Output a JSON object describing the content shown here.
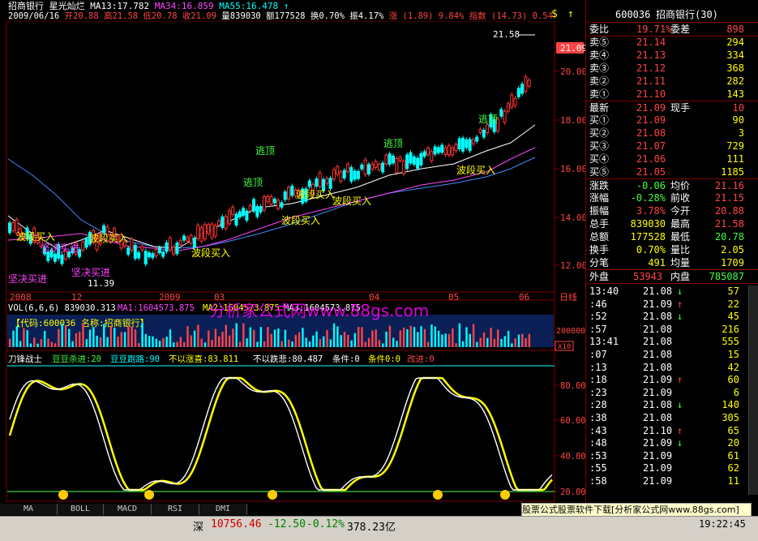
{
  "window": {
    "stock_name": "招商银行",
    "indicator_name": "星光灿烂",
    "ma13": "MA13:17.782",
    "ma34": "MA34:16.859",
    "ma55": "MA55:16.478",
    "date": "2009/06/16",
    "open": "开20.88",
    "high": "高21.58",
    "low": "低20.78",
    "close": "收21.09",
    "volume": "量839030",
    "amount": "额177528",
    "turnover": "换0.70%",
    "amplitude": "振4.17%",
    "change": "涨 (1.89) 9.84%",
    "index": "指数 (14.73) 0.54",
    "top_price": "21.58",
    "last_price": "21.09"
  },
  "price_axis": [
    "20.00",
    "18.00",
    "16.00",
    "14.00",
    "12.00"
  ],
  "date_axis": [
    "2008",
    "12",
    "2009",
    "03",
    "04",
    "05",
    "06"
  ],
  "date_axis_label": "日线",
  "annotations": {
    "escape": "逃顶",
    "band_buy": "波段买入",
    "decisive_buy": "坚决买进",
    "low_price": "11.39"
  },
  "volume_panel": {
    "header": "VOL(6,6,6) 839030.313",
    "ma1": "MA1:1604573.875",
    "ma2": "MA2:1604573.875",
    "ma3": "MA3:1604573.875",
    "code_label": "【代码:600036 名称:招商银行】",
    "axis_label": "200000",
    "x10": "X10"
  },
  "watermark": "分析家公式网www.88gs.com",
  "oscillator": {
    "name": "刀锋战士",
    "p1": "豆豆杀进:20",
    "p2": "豆豆跑路:90",
    "p3": "不以涨喜:83.811",
    "p4": "不以跌悲:80.487",
    "p5": "条件:0",
    "p6": "条件0:0",
    "p7": "改进:0",
    "axis": [
      "80.00",
      "60.00",
      "40.00",
      "20.00"
    ],
    "smiley_count": 5
  },
  "tabs": [
    "MA",
    "BOLL",
    "MACD",
    "RSI",
    "DMI"
  ],
  "quote": {
    "code": "600036",
    "name": "招商银行(30)",
    "weibi_label": "委比",
    "weibi_value": "19.71%",
    "weicha_label": "委差",
    "weicha_value": "898",
    "asks": [
      {
        "label": "卖⑤",
        "price": "21.14",
        "vol": "294"
      },
      {
        "label": "卖④",
        "price": "21.13",
        "vol": "334"
      },
      {
        "label": "卖③",
        "price": "21.12",
        "vol": "368"
      },
      {
        "label": "卖②",
        "price": "21.11",
        "vol": "282"
      },
      {
        "label": "卖①",
        "price": "21.10",
        "vol": "143"
      }
    ],
    "latest_label": "最新",
    "latest_value": "21.09",
    "hand_label": "现手",
    "hand_value": "10",
    "bids": [
      {
        "label": "买①",
        "price": "21.09",
        "vol": "90"
      },
      {
        "label": "买②",
        "price": "21.08",
        "vol": "3"
      },
      {
        "label": "买③",
        "price": "21.07",
        "vol": "729"
      },
      {
        "label": "买④",
        "price": "21.06",
        "vol": "111"
      },
      {
        "label": "买⑤",
        "price": "21.05",
        "vol": "1185"
      }
    ],
    "stats": [
      {
        "l1": "涨跌",
        "v1": "-0.06",
        "l2": "均价",
        "v2": "21.16"
      },
      {
        "l1": "涨幅",
        "v1": "-0.28%",
        "l2": "前收",
        "v2": "21.15"
      },
      {
        "l1": "振幅",
        "v1": "3.78%",
        "l2": "今开",
        "v2": "20.88"
      },
      {
        "l1": "总手",
        "v1": "839030",
        "l2": "最高",
        "v2": "21.58"
      },
      {
        "l1": "总额",
        "v1": "177528",
        "l2": "最低",
        "v2": "20.78"
      },
      {
        "l1": "换手",
        "v1": "0.70%",
        "l2": "量比",
        "v2": "2.05"
      },
      {
        "l1": "分笔",
        "v1": "491",
        "l2": "均量",
        "v2": "1709"
      }
    ],
    "outer_label": "外盘",
    "outer_value": "53943",
    "inner_label": "内盘",
    "inner_value": "785087"
  },
  "ticks": [
    {
      "t": "13:40",
      "p": "21.08",
      "a": "↓",
      "v": "57"
    },
    {
      "t": ":46",
      "p": "21.09",
      "a": "↑",
      "v": "22"
    },
    {
      "t": ":52",
      "p": "21.08",
      "a": "↓",
      "v": "45"
    },
    {
      "t": ":57",
      "p": "21.08",
      "a": "",
      "v": "216"
    },
    {
      "t": "13:41",
      "p": "21.08",
      "a": "",
      "v": "555"
    },
    {
      "t": ":07",
      "p": "21.08",
      "a": "",
      "v": "15"
    },
    {
      "t": ":13",
      "p": "21.08",
      "a": "",
      "v": "42"
    },
    {
      "t": ":18",
      "p": "21.09",
      "a": "↑",
      "v": "60"
    },
    {
      "t": ":23",
      "p": "21.09",
      "a": "",
      "v": "6"
    },
    {
      "t": ":28",
      "p": "21.08",
      "a": "↓",
      "v": "140"
    },
    {
      "t": ":38",
      "p": "21.08",
      "a": "",
      "v": "305"
    },
    {
      "t": ":43",
      "p": "21.10",
      "a": "↑",
      "v": "65"
    },
    {
      "t": ":48",
      "p": "21.09",
      "a": "↓",
      "v": "20"
    },
    {
      "t": ":53",
      "p": "21.09",
      "a": "",
      "v": "61"
    },
    {
      "t": ":55",
      "p": "21.09",
      "a": "",
      "v": "62"
    },
    {
      "t": ":58",
      "p": "21.09",
      "a": "",
      "v": "11"
    }
  ],
  "status": {
    "market": "深",
    "index": "10756.46",
    "change": "-12.50",
    "pct": "-0.12%",
    "amount": "378.23亿",
    "time": "19:22:45"
  },
  "banner": "股票公式股票软件下载[分析家公式网www.88gs.com]"
}
